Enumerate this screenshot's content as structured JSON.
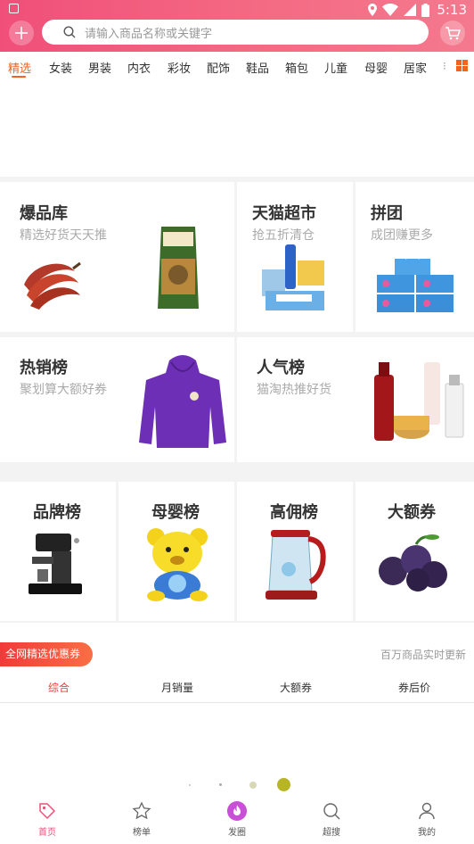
{
  "status_bar": {
    "time": "5:13"
  },
  "search": {
    "placeholder": "请输入商品名称或关键字"
  },
  "categories": [
    {
      "label": "精选",
      "active": true
    },
    {
      "label": "女装"
    },
    {
      "label": "男装"
    },
    {
      "label": "内衣"
    },
    {
      "label": "彩妆"
    },
    {
      "label": "配饰"
    },
    {
      "label": "鞋品"
    },
    {
      "label": "箱包"
    },
    {
      "label": "儿童"
    },
    {
      "label": "母婴"
    },
    {
      "label": "居家"
    }
  ],
  "cards_row1": {
    "baopinku": {
      "title": "爆品库",
      "subtitle": "精选好货天天推"
    },
    "tmall": {
      "title": "天猫超市",
      "subtitle": "抢五折清仓"
    },
    "pintuan": {
      "title": "拼团",
      "subtitle": "成团赚更多"
    }
  },
  "cards_row2": {
    "rexiao": {
      "title": "热销榜",
      "subtitle": "聚划算大额好券"
    },
    "renqi": {
      "title": "人气榜",
      "subtitle": "猫淘热推好货"
    }
  },
  "cards_row3": [
    {
      "title": "品牌榜"
    },
    {
      "title": "母婴榜"
    },
    {
      "title": "高佣榜"
    },
    {
      "title": "大额券"
    }
  ],
  "coupon": {
    "badge": "全网精选优惠券",
    "note": "百万商品实时更新"
  },
  "sort_tabs": [
    {
      "label": "综合",
      "active": true
    },
    {
      "label": "月销量"
    },
    {
      "label": "大额券"
    },
    {
      "label": "券后价"
    }
  ],
  "tabbar": [
    {
      "label": "首页",
      "icon": "tag-icon",
      "active": true
    },
    {
      "label": "榜单",
      "icon": "star-icon"
    },
    {
      "label": "发圈",
      "icon": "flame-icon"
    },
    {
      "label": "超搜",
      "icon": "search-icon"
    },
    {
      "label": "我的",
      "icon": "person-icon"
    }
  ],
  "colors": {
    "brand": "#f04f79",
    "accent": "#f2631c",
    "coupon_red": "#ef3b3b"
  }
}
